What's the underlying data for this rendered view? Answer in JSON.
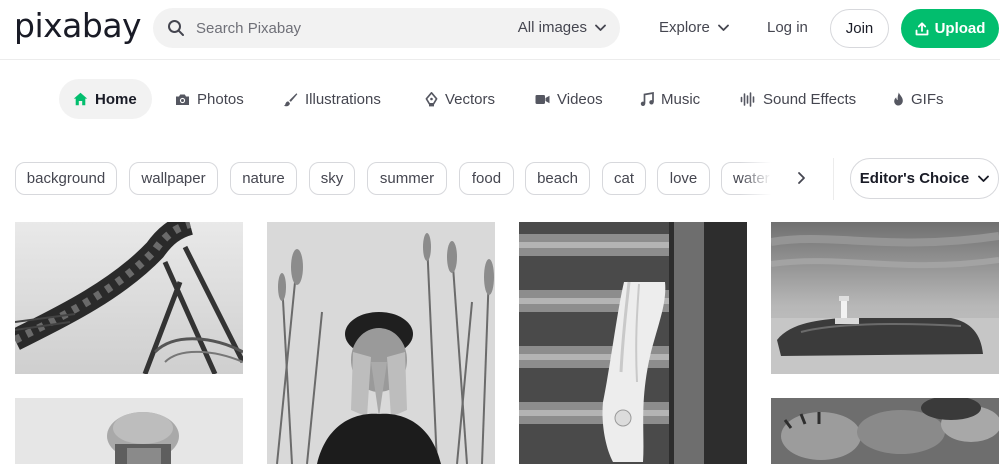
{
  "header": {
    "logo": "pixabay",
    "search": {
      "placeholder": "Search Pixabay",
      "filter_label": "All images"
    },
    "explore_label": "Explore",
    "login_label": "Log in",
    "join_label": "Join",
    "upload_label": "Upload",
    "accent_color": "#02be6e"
  },
  "tabs": [
    {
      "label": "Home",
      "icon": "home-icon",
      "active": true
    },
    {
      "label": "Photos",
      "icon": "camera-icon",
      "active": false
    },
    {
      "label": "Illustrations",
      "icon": "brush-icon",
      "active": false
    },
    {
      "label": "Vectors",
      "icon": "pen-nib-icon",
      "active": false
    },
    {
      "label": "Videos",
      "icon": "video-camera-icon",
      "active": false
    },
    {
      "label": "Music",
      "icon": "music-note-icon",
      "active": false
    },
    {
      "label": "Sound Effects",
      "icon": "waveform-icon",
      "active": false
    },
    {
      "label": "GIFs",
      "icon": "flame-icon",
      "active": false
    }
  ],
  "tags": [
    "background",
    "wallpaper",
    "nature",
    "sky",
    "summer",
    "food",
    "beach",
    "cat",
    "love",
    "water"
  ],
  "sort": {
    "label": "Editor's Choice"
  },
  "gallery": [
    {
      "subject": "roller coaster",
      "icon": "photo-thumbnail"
    },
    {
      "subject": "person in hat",
      "icon": "photo-thumbnail"
    },
    {
      "subject": "man covering face in grass",
      "icon": "photo-thumbnail"
    },
    {
      "subject": "high heel shoe on railing",
      "icon": "photo-thumbnail"
    },
    {
      "subject": "lighthouse island",
      "icon": "photo-thumbnail"
    },
    {
      "subject": "animal paws",
      "icon": "photo-thumbnail"
    }
  ]
}
